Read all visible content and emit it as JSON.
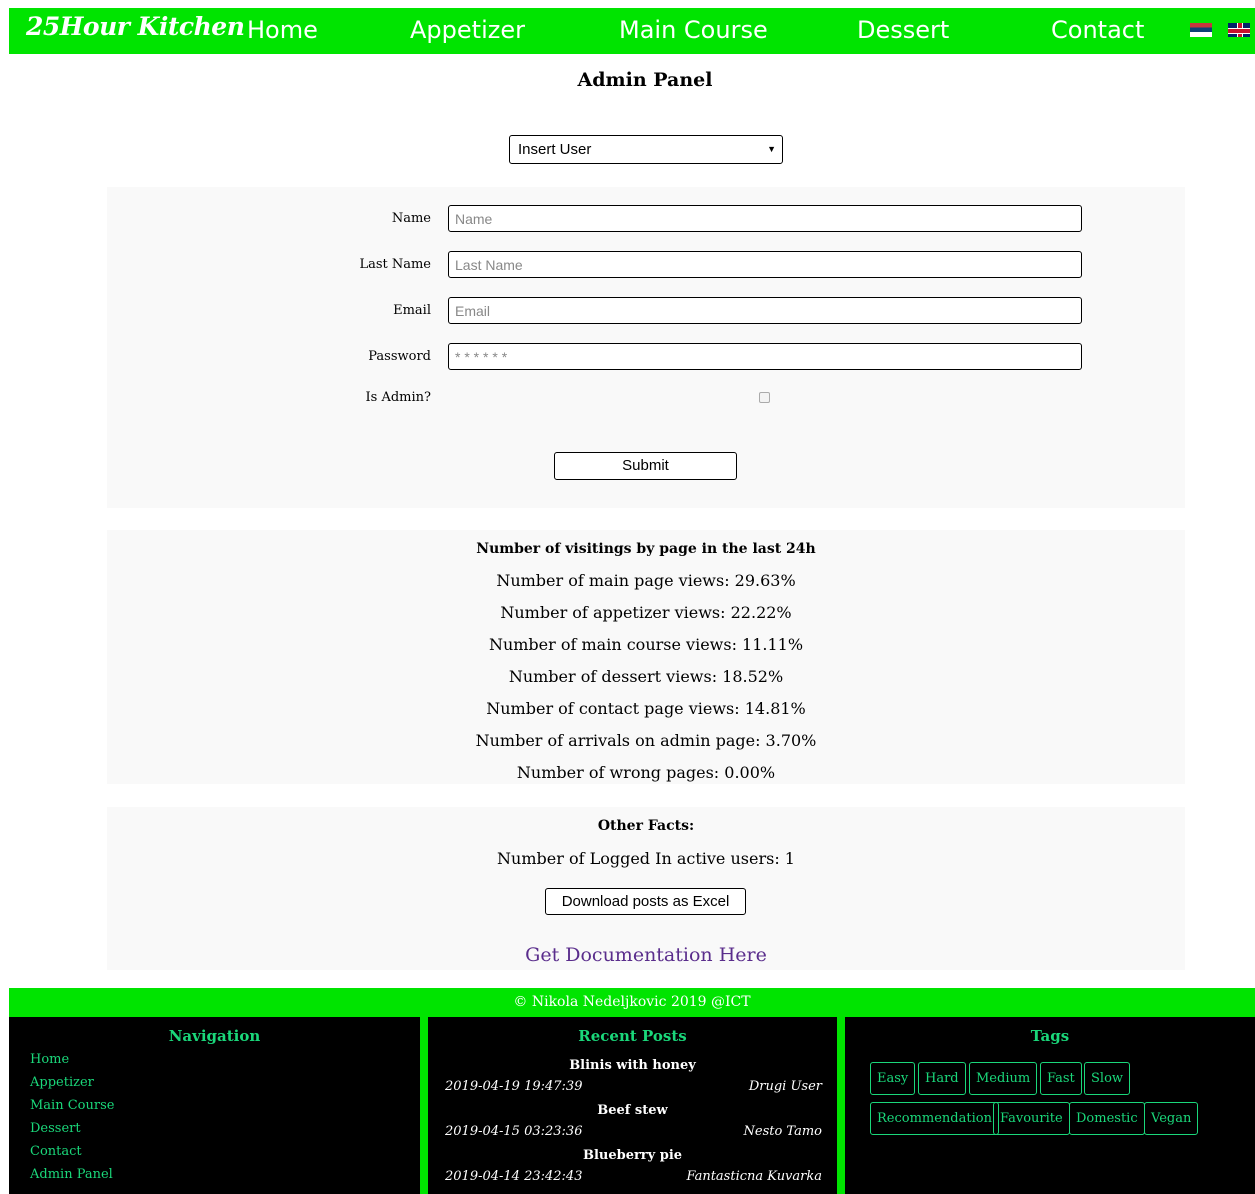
{
  "navbar": {
    "brand": "25Hour Kitchen",
    "links": [
      "Home",
      "Appetizer",
      "Main Course",
      "Dessert",
      "Contact"
    ]
  },
  "page_title": "Admin Panel",
  "action_select": {
    "selected": "Insert User"
  },
  "form": {
    "fields": [
      {
        "label": "Name",
        "placeholder": "Name"
      },
      {
        "label": "Last Name",
        "placeholder": "Last Name"
      },
      {
        "label": "Email",
        "placeholder": "Email"
      },
      {
        "label": "Password",
        "placeholder": "* * * * * *"
      }
    ],
    "admin_label": "Is Admin?",
    "admin_checked": false,
    "submit_label": "Submit"
  },
  "stats": {
    "title": "Number of visitings by page in the last 24h",
    "lines": [
      "Number of main page views: 29.63%",
      "Number of appetizer views: 22.22%",
      "Number of main course views: 11.11%",
      "Number of dessert views: 18.52%",
      "Number of contact page views: 14.81%",
      "Number of arrivals on admin page: 3.70%",
      "Number of wrong pages: 0.00%"
    ]
  },
  "facts": {
    "title": "Other Facts:",
    "logged_in": "Number of Logged In active users: 1",
    "download_label": "Download posts as Excel",
    "doc_link": "Get Documentation Here"
  },
  "footer": {
    "copyright": "© Nikola Nedeljkovic 2019    @ICT",
    "navigation": {
      "heading": "Navigation",
      "links": [
        "Home",
        "Appetizer",
        "Main Course",
        "Dessert",
        "Contact",
        "Admin Panel"
      ]
    },
    "recent_posts": {
      "heading": "Recent Posts",
      "posts": [
        {
          "title": "Blinis with honey",
          "date": "2019-04-19 19:47:39",
          "author": "Drugi User"
        },
        {
          "title": "Beef stew",
          "date": "2019-04-15 03:23:36",
          "author": "Nesto Tamo"
        },
        {
          "title": "Blueberry pie",
          "date": "2019-04-14 23:42:43",
          "author": "Fantasticna Kuvarka"
        }
      ]
    },
    "tags": {
      "heading": "Tags",
      "items": [
        "Easy",
        "Hard",
        "Medium",
        "Fast",
        "Slow",
        "Recommendation",
        "Favourite",
        "Domestic",
        "Vegan"
      ]
    }
  },
  "colors": {
    "brand_green": "#00e400",
    "footer_text_green": "#1ad77a",
    "doc_link": "#5a2d8c"
  }
}
